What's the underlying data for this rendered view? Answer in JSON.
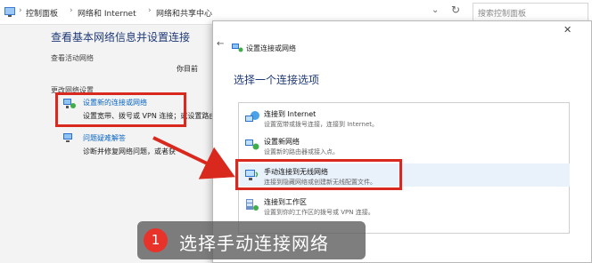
{
  "address_bar": {
    "crumbs": [
      "控制面板",
      "网络和 Internet",
      "网络和共享中心"
    ],
    "search_placeholder": "搜索控制面板"
  },
  "control_panel": {
    "heading": "查看基本网络信息并设置连接",
    "active_networks_label": "查看活动网络",
    "partial_text": "你目前",
    "change_settings_label": "更改网络设置",
    "new_connection_link": "设置新的连接或网络",
    "new_connection_desc": "设置宽带、拨号或 VPN 连接；或设置路由",
    "troubleshoot_link": "问题疑难解答",
    "troubleshoot_desc": "诊断并修复网络问题，或者获"
  },
  "dialog": {
    "close_glyph": "✕",
    "title": "设置连接或网络",
    "heading": "选择一个连接选项",
    "options": [
      {
        "title": "连接到 Internet",
        "desc": "设置宽带或拨号连接，连接到 Internet。"
      },
      {
        "title": "设置新网络",
        "desc": "设置新的路由器或接入点。"
      },
      {
        "title": "手动连接到无线网络",
        "desc": "连接到隐藏网络或创建新无线配置文件。"
      },
      {
        "title": "连接到工作区",
        "desc": "设置到你的工作区的拨号或 VPN 连接。"
      }
    ]
  },
  "annotation": {
    "step_number": "1",
    "caption": "选择手动连接网络"
  },
  "colors": {
    "highlight_red": "#d9281e",
    "badge_red": "#e8332a",
    "link_blue": "#0a66c2",
    "heading_blue": "#1f3a77"
  }
}
